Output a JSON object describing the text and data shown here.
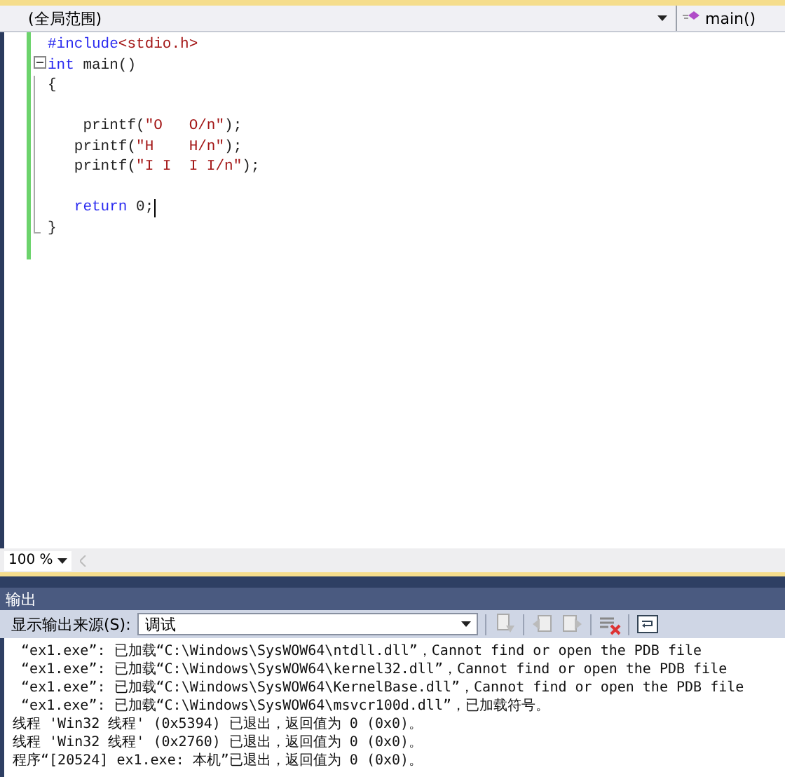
{
  "navigation": {
    "scope": "(全局范围)",
    "member": "main()"
  },
  "code_lines": [
    {
      "collapsible": false,
      "caret": false,
      "segments": [
        {
          "kind": "preproc",
          "text": "#include"
        },
        {
          "kind": "string",
          "text": "<stdio.h>"
        }
      ]
    },
    {
      "collapsible": true,
      "caret": false,
      "segments": [
        {
          "kind": "keyword",
          "text": "int"
        },
        {
          "kind": "plain",
          "text": " main()"
        }
      ]
    },
    {
      "collapsible": false,
      "caret": false,
      "segments": [
        {
          "kind": "plain",
          "text": "{"
        }
      ]
    },
    {
      "collapsible": false,
      "caret": false
    },
    {
      "collapsible": false,
      "caret": false,
      "segments": [
        {
          "kind": "plain",
          "text": "    printf("
        },
        {
          "kind": "string",
          "text": "\"O   O/n\""
        },
        {
          "kind": "plain",
          "text": ");"
        }
      ]
    },
    {
      "collapsible": false,
      "caret": false,
      "segments": [
        {
          "kind": "plain",
          "text": "   printf("
        },
        {
          "kind": "string",
          "text": "\"H    H/n\""
        },
        {
          "kind": "plain",
          "text": ");"
        }
      ]
    },
    {
      "collapsible": false,
      "caret": false,
      "segments": [
        {
          "kind": "plain",
          "text": "   printf("
        },
        {
          "kind": "string",
          "text": "\"I I  I I/n\""
        },
        {
          "kind": "plain",
          "text": ");"
        }
      ]
    },
    {
      "collapsible": false,
      "caret": false
    },
    {
      "collapsible": false,
      "caret": true,
      "segments": [
        {
          "kind": "keyword",
          "text": "   return"
        },
        {
          "kind": "plain",
          "text": " 0;"
        }
      ]
    },
    {
      "collapsible": false,
      "caret": false,
      "segments": [
        {
          "kind": "plain",
          "text": "}"
        }
      ]
    }
  ],
  "zoom": "100 %",
  "output": {
    "title": "输出",
    "source_label": "显示输出来源(S):",
    "source": "调试",
    "lines": [
      "  “ex1.exe”: 已加载“C:\\Windows\\SysWOW64\\ntdll.dll”，Cannot find or open the PDB file",
      "  “ex1.exe”: 已加载“C:\\Windows\\SysWOW64\\kernel32.dll”，Cannot find or open the PDB file",
      "  “ex1.exe”: 已加载“C:\\Windows\\SysWOW64\\KernelBase.dll”，Cannot find or open the PDB file",
      "  “ex1.exe”: 已加载“C:\\Windows\\SysWOW64\\msvcr100d.dll”，已加载符号。",
      " 线程 'Win32 线程' (0x5394) 已退出，返回值为 0 (0x0)。",
      " 线程 'Win32 线程' (0x2760) 已退出，返回值为 0 (0x0)。",
      " 程序“[20524] ex1.exe: 本机”已退出，返回值为 0 (0x0)。"
    ]
  }
}
